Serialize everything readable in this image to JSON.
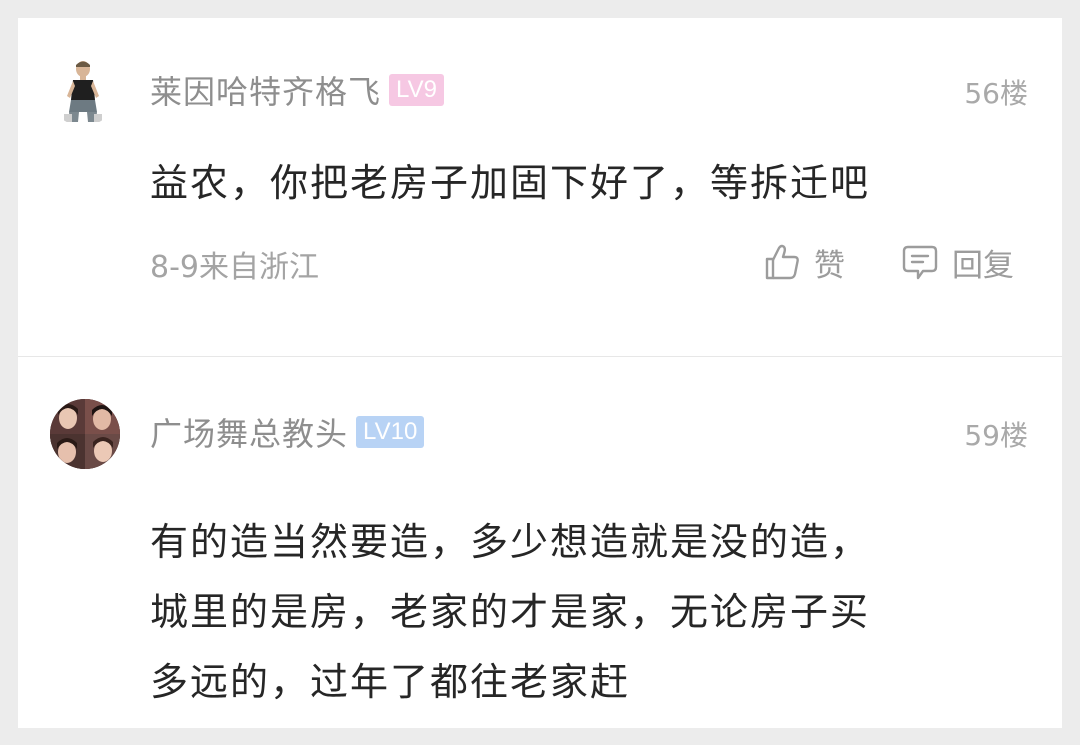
{
  "comments": [
    {
      "username": "莱因哈特齐格飞",
      "level": "LV9",
      "level_color": "#f6c8e3",
      "floor": "56楼",
      "content": "益农，你把老房子加固下好了，等拆迁吧",
      "meta": "8-9来自浙江",
      "like_label": "赞",
      "reply_label": "回复"
    },
    {
      "username": "广场舞总教头",
      "level": "LV10",
      "level_color": "#b8d3f5",
      "floor": "59楼",
      "content_lines": [
        "有的造当然要造，多少想造就是没的造，",
        "城里的是房，老家的才是家，无论房子买",
        "多远的，过年了都往老家赶"
      ]
    }
  ],
  "icons": {
    "like": "thumbs-up-icon",
    "reply": "comment-bubble-icon"
  }
}
